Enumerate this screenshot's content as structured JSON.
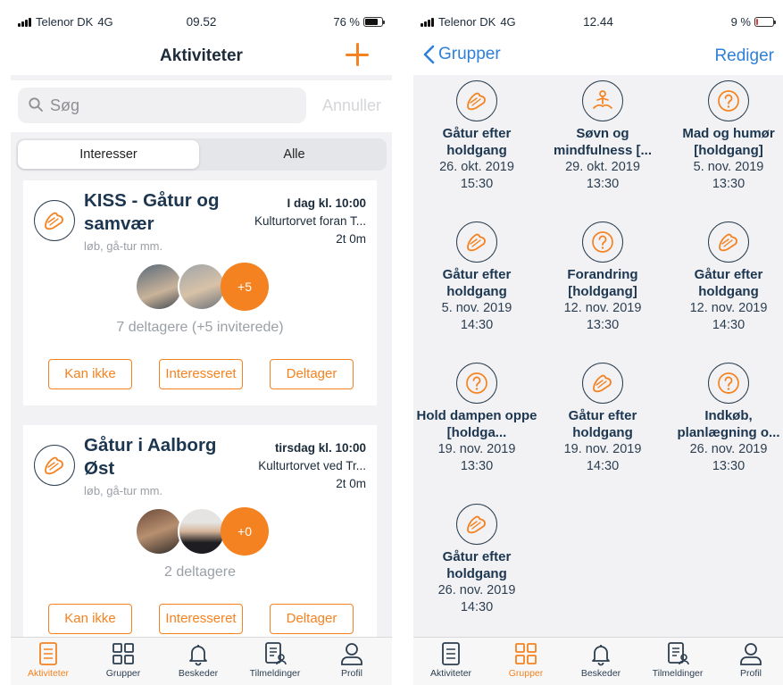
{
  "left_phone": {
    "status": {
      "carrier": "Telenor DK",
      "network": "4G",
      "time": "09.52",
      "battery": "76 %",
      "battery_level": 0.76
    },
    "nav": {
      "title": "Aktiviteter"
    },
    "search": {
      "placeholder": "Søg",
      "cancel": "Annuller"
    },
    "segments": {
      "active": "Interesser",
      "inactive": "Alle"
    },
    "cards": [
      {
        "title": "KISS - Gåtur og samvær",
        "subtitle": "løb, gå-tur mm.",
        "when": "I dag kl. 10:00",
        "where": "Kulturtorvet foran T...",
        "duration": "2t 0m",
        "more": "+5",
        "count": "7 deltagere (+5 inviterede)",
        "btn_no": "Kan ikke",
        "btn_interested": "Interesseret",
        "btn_join": "Deltager"
      },
      {
        "title": "Gåtur i Aalborg Øst",
        "subtitle": "løb, gå-tur mm.",
        "when": "tirsdag kl. 10:00",
        "where": "Kulturtorvet ved Tr...",
        "duration": "2t 0m",
        "more": "+0",
        "count": "2 deltagere",
        "btn_no": "Kan ikke",
        "btn_interested": "Interesseret",
        "btn_join": "Deltager"
      }
    ],
    "tabs": [
      "Aktiviteter",
      "Grupper",
      "Beskeder",
      "Tilmeldinger",
      "Profil"
    ]
  },
  "right_phone": {
    "status": {
      "carrier": "Telenor DK",
      "network": "4G",
      "time": "12.44",
      "battery": "9 %",
      "battery_level": 0.09
    },
    "nav": {
      "back": "Grupper",
      "edit": "Rediger"
    },
    "groups": [
      {
        "icon": "shoe-icon",
        "title": "Gåtur efter holdgang",
        "date": "26. okt. 2019",
        "time": "15:30"
      },
      {
        "icon": "meditation-icon",
        "title": "Søvn og mindfulness [...",
        "date": "29. okt. 2019",
        "time": "13:30"
      },
      {
        "icon": "question-icon",
        "title": "Mad og humør [holdgang]",
        "date": "5. nov. 2019",
        "time": "13:30"
      },
      {
        "icon": "shoe-icon",
        "title": "Gåtur efter holdgang",
        "date": "5. nov. 2019",
        "time": "14:30"
      },
      {
        "icon": "question-icon",
        "title": "Forandring [holdgang]",
        "date": "12. nov. 2019",
        "time": "13:30"
      },
      {
        "icon": "shoe-icon",
        "title": "Gåtur efter holdgang",
        "date": "12. nov. 2019",
        "time": "14:30"
      },
      {
        "icon": "question-icon",
        "title": "Hold dampen oppe [holdga...",
        "date": "19. nov. 2019",
        "time": "13:30"
      },
      {
        "icon": "shoe-icon",
        "title": "Gåtur efter holdgang",
        "date": "19. nov. 2019",
        "time": "14:30"
      },
      {
        "icon": "question-icon",
        "title": "Indkøb, planlægning o...",
        "date": "26. nov. 2019",
        "time": "13:30"
      },
      {
        "icon": "shoe-icon",
        "title": "Gåtur efter holdgang",
        "date": "26. nov. 2019",
        "time": "14:30"
      }
    ],
    "tabs": [
      "Aktiviteter",
      "Grupper",
      "Beskeder",
      "Tilmeldinger",
      "Profil"
    ]
  },
  "colors": {
    "accent": "#f58220",
    "link": "#2f80d8",
    "text": "#1c3650",
    "battery_low": "#e53935"
  },
  "active_tab": "Grupper"
}
